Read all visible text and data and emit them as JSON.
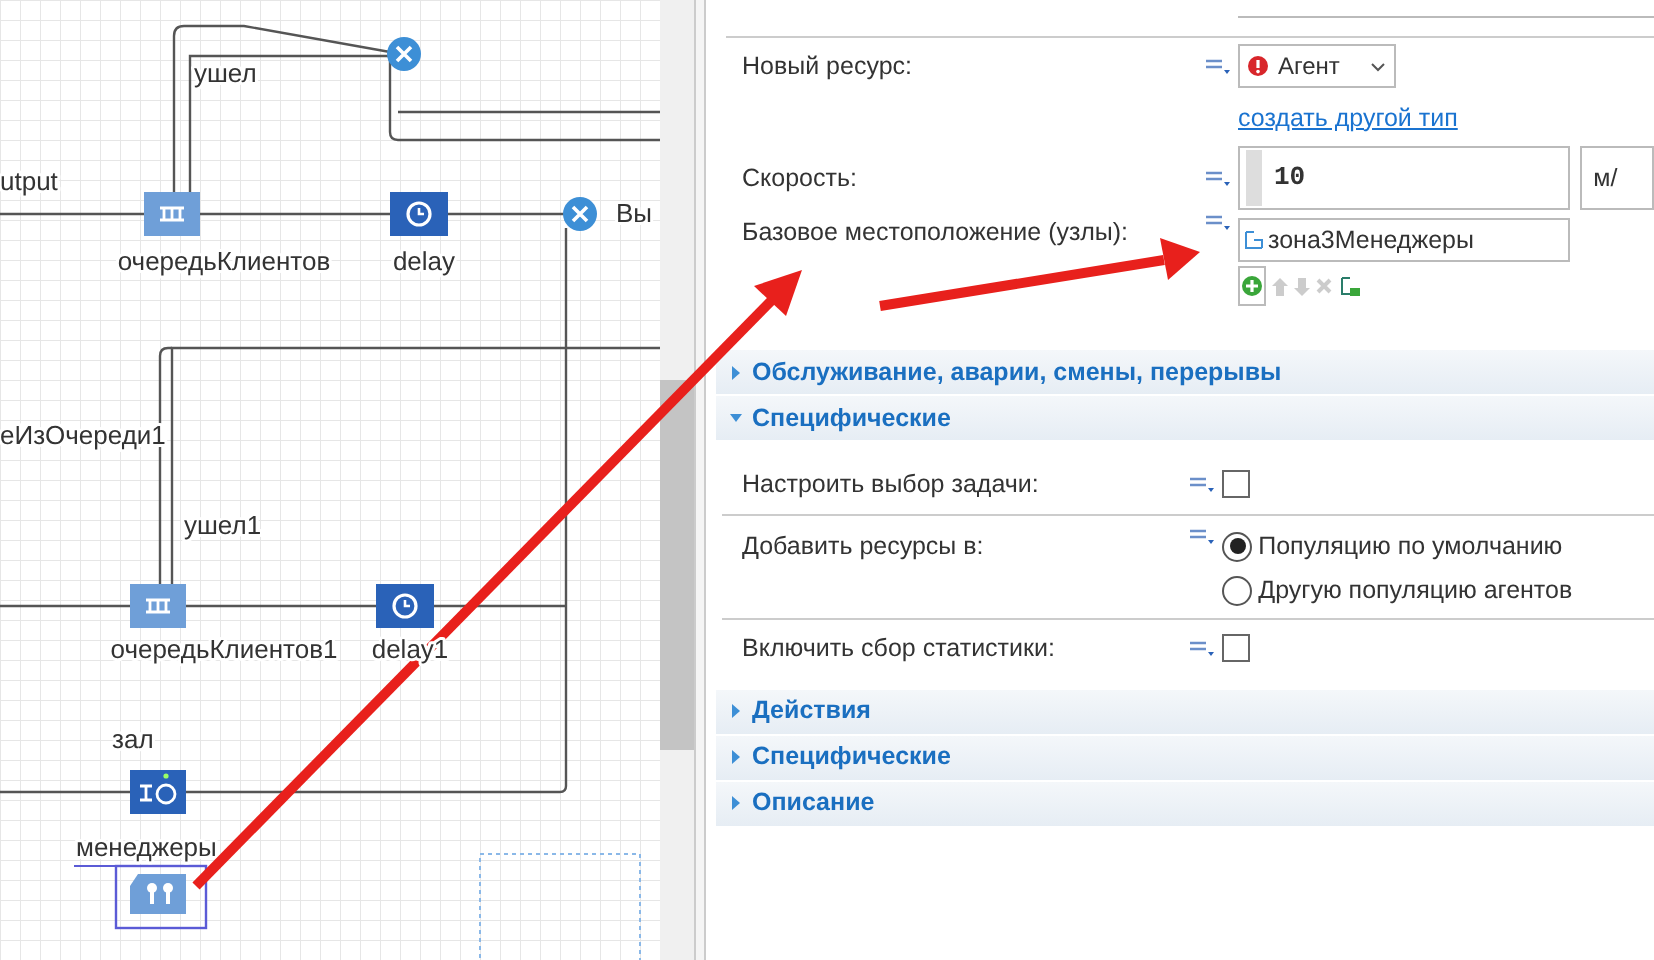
{
  "canvas": {
    "labels": [
      "ушел",
      "utput",
      "Вы",
      "еИзОчереди1",
      "ушел1",
      "зал",
      "менеджеры"
    ],
    "blocks": [
      {
        "kind": "sink",
        "selected": false
      },
      {
        "kind": "queue",
        "label": "очередьКлиентов",
        "selected": false
      },
      {
        "kind": "delay",
        "label": "delay",
        "selected": false
      },
      {
        "kind": "sink",
        "selected": false
      },
      {
        "kind": "queue",
        "label": "очередьКлиентов1",
        "selected": false
      },
      {
        "kind": "delay",
        "label": "delay1",
        "selected": false
      },
      {
        "kind": "pool",
        "selected": false
      },
      {
        "kind": "resource",
        "selected": true
      }
    ]
  },
  "properties": {
    "rows": [
      {
        "kind": "dropdown",
        "label": "Новый ресурс:",
        "value": "Агент"
      },
      {
        "kind": "link",
        "text": "создать другой тип"
      },
      {
        "kind": "number",
        "label": "Скорость:",
        "value": "10",
        "unit": "м/"
      },
      {
        "kind": "list",
        "label": "Базовое местоположение (узлы):",
        "value": "зона3Менеджеры"
      }
    ],
    "sections": [
      {
        "title": "Обслуживание, аварии, смены, перерывы",
        "expanded": false
      },
      {
        "title": "Специфические",
        "expanded": true,
        "rows": [
          {
            "kind": "checkbox",
            "label": "Настроить выбор задачи:",
            "checked": false
          },
          {
            "kind": "radio",
            "label": "Добавить ресурсы в:",
            "options": [
              {
                "label": "Популяцию по умолчанию",
                "selected": true
              },
              {
                "label": "Другую популяцию агентов",
                "selected": false
              }
            ]
          },
          {
            "kind": "checkbox",
            "label": "Включить сбор статистики:",
            "checked": false
          }
        ]
      },
      {
        "title": "Действия",
        "expanded": false
      },
      {
        "title": "Специфические",
        "expanded": false
      },
      {
        "title": "Описание",
        "expanded": false
      }
    ]
  }
}
